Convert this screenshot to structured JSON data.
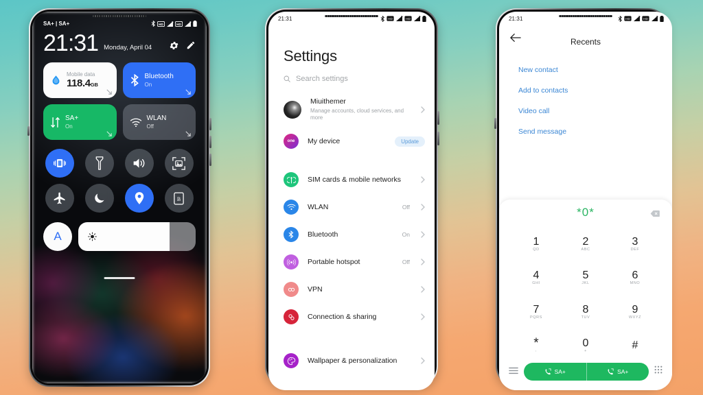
{
  "background": {
    "top_color": "#5cc6c6",
    "bottom_color": "#f3a268"
  },
  "phone1": {
    "label": "control-center",
    "statusbar": {
      "left_text": "SA+ | SA+",
      "icons": [
        "bluetooth-icon",
        "hd-icon",
        "signal-icon",
        "hd-icon",
        "signal-icon",
        "battery-icon"
      ]
    },
    "clock": {
      "time": "21:31",
      "date": "Monday, April 04"
    },
    "header_actions": [
      {
        "name": "settings-gear-icon",
        "label": "Settings"
      },
      {
        "name": "edit-pencil-icon",
        "label": "Edit"
      }
    ],
    "tiles": [
      {
        "name": "mobile-data-tile",
        "label": "Mobile data",
        "value": "118.4",
        "unit": "GB",
        "style": "white"
      },
      {
        "name": "bluetooth-tile",
        "label": "Bluetooth",
        "state": "On",
        "style": "blue"
      },
      {
        "name": "data-connection-tile",
        "label": "SA+",
        "state": "On",
        "style": "green"
      },
      {
        "name": "wlan-tile",
        "label": "WLAN",
        "state": "Off",
        "style": "grey"
      }
    ],
    "toggles": [
      {
        "name": "vibrate-toggle",
        "icon": "vibrate-icon",
        "on": true
      },
      {
        "name": "flashlight-toggle",
        "icon": "flashlight-icon",
        "on": false
      },
      {
        "name": "sound-toggle",
        "icon": "speaker-icon",
        "on": false
      },
      {
        "name": "screenshot-toggle",
        "icon": "screenshot-icon",
        "on": false
      },
      {
        "name": "airplane-toggle",
        "icon": "airplane-icon",
        "on": false
      },
      {
        "name": "dnd-toggle",
        "icon": "moon-icon",
        "on": false
      },
      {
        "name": "location-toggle",
        "icon": "location-pin-icon",
        "on": true
      },
      {
        "name": "reading-mode-toggle",
        "icon": "reading-mode-icon",
        "on": false
      }
    ],
    "brightness": {
      "auto_label": "A",
      "level_percent": 78,
      "icon": "sun-icon"
    }
  },
  "phone2": {
    "label": "settings-app",
    "statusbar": {
      "left_text": "21:31",
      "icons": [
        "bluetooth-icon",
        "hd-icon",
        "signal-icon",
        "hd-icon",
        "signal-icon",
        "battery-icon"
      ]
    },
    "title": "Settings",
    "search": {
      "placeholder": "Search settings",
      "icon": "search-icon"
    },
    "account": {
      "name": "Miuithemer",
      "desc": "Manage accounts, cloud services, and more"
    },
    "device": {
      "name": "My device",
      "badge": "Update",
      "icon_text": "one"
    },
    "rows": [
      {
        "name": "SIM cards & mobile networks",
        "value": "",
        "color": "#1ec57b",
        "icon": "sim-tower-icon"
      },
      {
        "name": "WLAN",
        "value": "Off",
        "color": "#2a86e8",
        "icon": "wifi-icon"
      },
      {
        "name": "Bluetooth",
        "value": "On",
        "color": "#2a86e8",
        "icon": "bluetooth-icon"
      },
      {
        "name": "Portable hotspot",
        "value": "Off",
        "color": "#c05fe0",
        "icon": "hotspot-icon"
      },
      {
        "name": "VPN",
        "value": "",
        "color": "#f08a8a",
        "icon": "vpn-icon"
      },
      {
        "name": "Connection & sharing",
        "value": "",
        "color": "#d6243a",
        "icon": "link-icon"
      }
    ],
    "rows2": [
      {
        "name": "Wallpaper & personalization",
        "value": "",
        "color": "#a622c9",
        "icon": "palette-icon"
      }
    ]
  },
  "phone3": {
    "label": "dialer-app",
    "statusbar": {
      "left_text": "21:31",
      "icons": [
        "bluetooth-icon",
        "hd-icon",
        "signal-icon",
        "hd-icon",
        "signal-icon",
        "battery-icon"
      ]
    },
    "header": {
      "title": "Recents",
      "back_icon": "arrow-left-icon"
    },
    "links": [
      "New contact",
      "Add to contacts",
      "Video call",
      "Send message"
    ],
    "dialed_number": "*0*",
    "delete_icon": "backspace-icon",
    "keys": [
      {
        "digit": "1",
        "letters": "QD"
      },
      {
        "digit": "2",
        "letters": "ABC"
      },
      {
        "digit": "3",
        "letters": "DEF"
      },
      {
        "digit": "4",
        "letters": "GHI"
      },
      {
        "digit": "5",
        "letters": "JKL"
      },
      {
        "digit": "6",
        "letters": "MNO"
      },
      {
        "digit": "7",
        "letters": "PQRS"
      },
      {
        "digit": "8",
        "letters": "TUV"
      },
      {
        "digit": "9",
        "letters": "WXYZ"
      },
      {
        "digit": "*",
        "letters": ","
      },
      {
        "digit": "0",
        "letters": "+"
      },
      {
        "digit": "#",
        "letters": ""
      }
    ],
    "bottom": {
      "menu_icon": "menu-icon",
      "keypad_icon": "keypad-icon",
      "call_sim1": "SA+",
      "call_sim2": "SA+",
      "call_color": "#1eb860"
    }
  }
}
